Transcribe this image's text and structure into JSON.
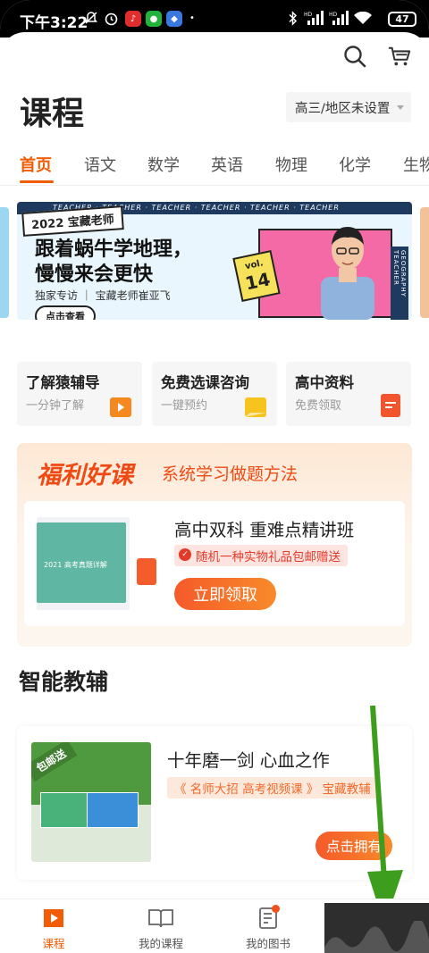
{
  "status_bar": {
    "time": "下午3:22",
    "signal1": "HD",
    "signal2": "HD",
    "battery": "47"
  },
  "header": {
    "title": "课程",
    "grade_selector": "高三/地区未设置",
    "icons": [
      "search-icon",
      "cart-icon"
    ]
  },
  "tabs": [
    {
      "label": "首页",
      "active": true
    },
    {
      "label": "语文"
    },
    {
      "label": "数学"
    },
    {
      "label": "英语"
    },
    {
      "label": "物理"
    },
    {
      "label": "化学"
    },
    {
      "label": "生物"
    }
  ],
  "banner": {
    "stripe_text": "TEACHER · TEACHER · TEACHER · TEACHER · TEACHER · TEACHER",
    "tag": "2022 宝藏老师",
    "headline_line1": "跟着蜗牛学地理，",
    "headline_line2": "慢慢来会更快",
    "subtitle": "独家专访 ｜ 宝藏老师崔亚飞",
    "button": "点击查看",
    "vol_label": "vol.",
    "vol_number": "14",
    "side_text": "GEOGRAPHY TEACHER"
  },
  "quick_cards": [
    {
      "title": "了解猿辅导",
      "subtitle": "一分钟了解",
      "icon": "play-icon",
      "icon_color": "#f5891f"
    },
    {
      "title": "免费选课咨询",
      "subtitle": "一键预约",
      "icon": "chat-icon",
      "icon_color": "#f7c31f"
    },
    {
      "title": "高中资料",
      "subtitle": "免费领取",
      "icon": "document-icon",
      "icon_color": "#f2542d"
    }
  ],
  "promo": {
    "title": "福利好课",
    "subtitle": "系统学习做题方法",
    "book_label": "2021 高考真题详解",
    "course_title": "高中双科 重难点精讲班",
    "badge": "随机一种实物礼品包邮赠送",
    "button": "立即领取"
  },
  "smart_section": {
    "title": "智能教辅",
    "card": {
      "ribbon": "包邮送",
      "title": "十年磨一剑 心血之作",
      "tags": "《 名师大招 高考视频课 》 宝藏教辅",
      "button": "点击拥有"
    }
  },
  "bottom_nav": [
    {
      "label": "课程",
      "icon": "play-square-icon",
      "active": true
    },
    {
      "label": "我的课程",
      "icon": "book-open-icon"
    },
    {
      "label": "我的图书",
      "icon": "notebook-icon",
      "badge_dot": true
    }
  ],
  "colors": {
    "accent": "#f25c05",
    "promo_red": "#f04a14",
    "arrow_green": "#3c9e1c"
  }
}
